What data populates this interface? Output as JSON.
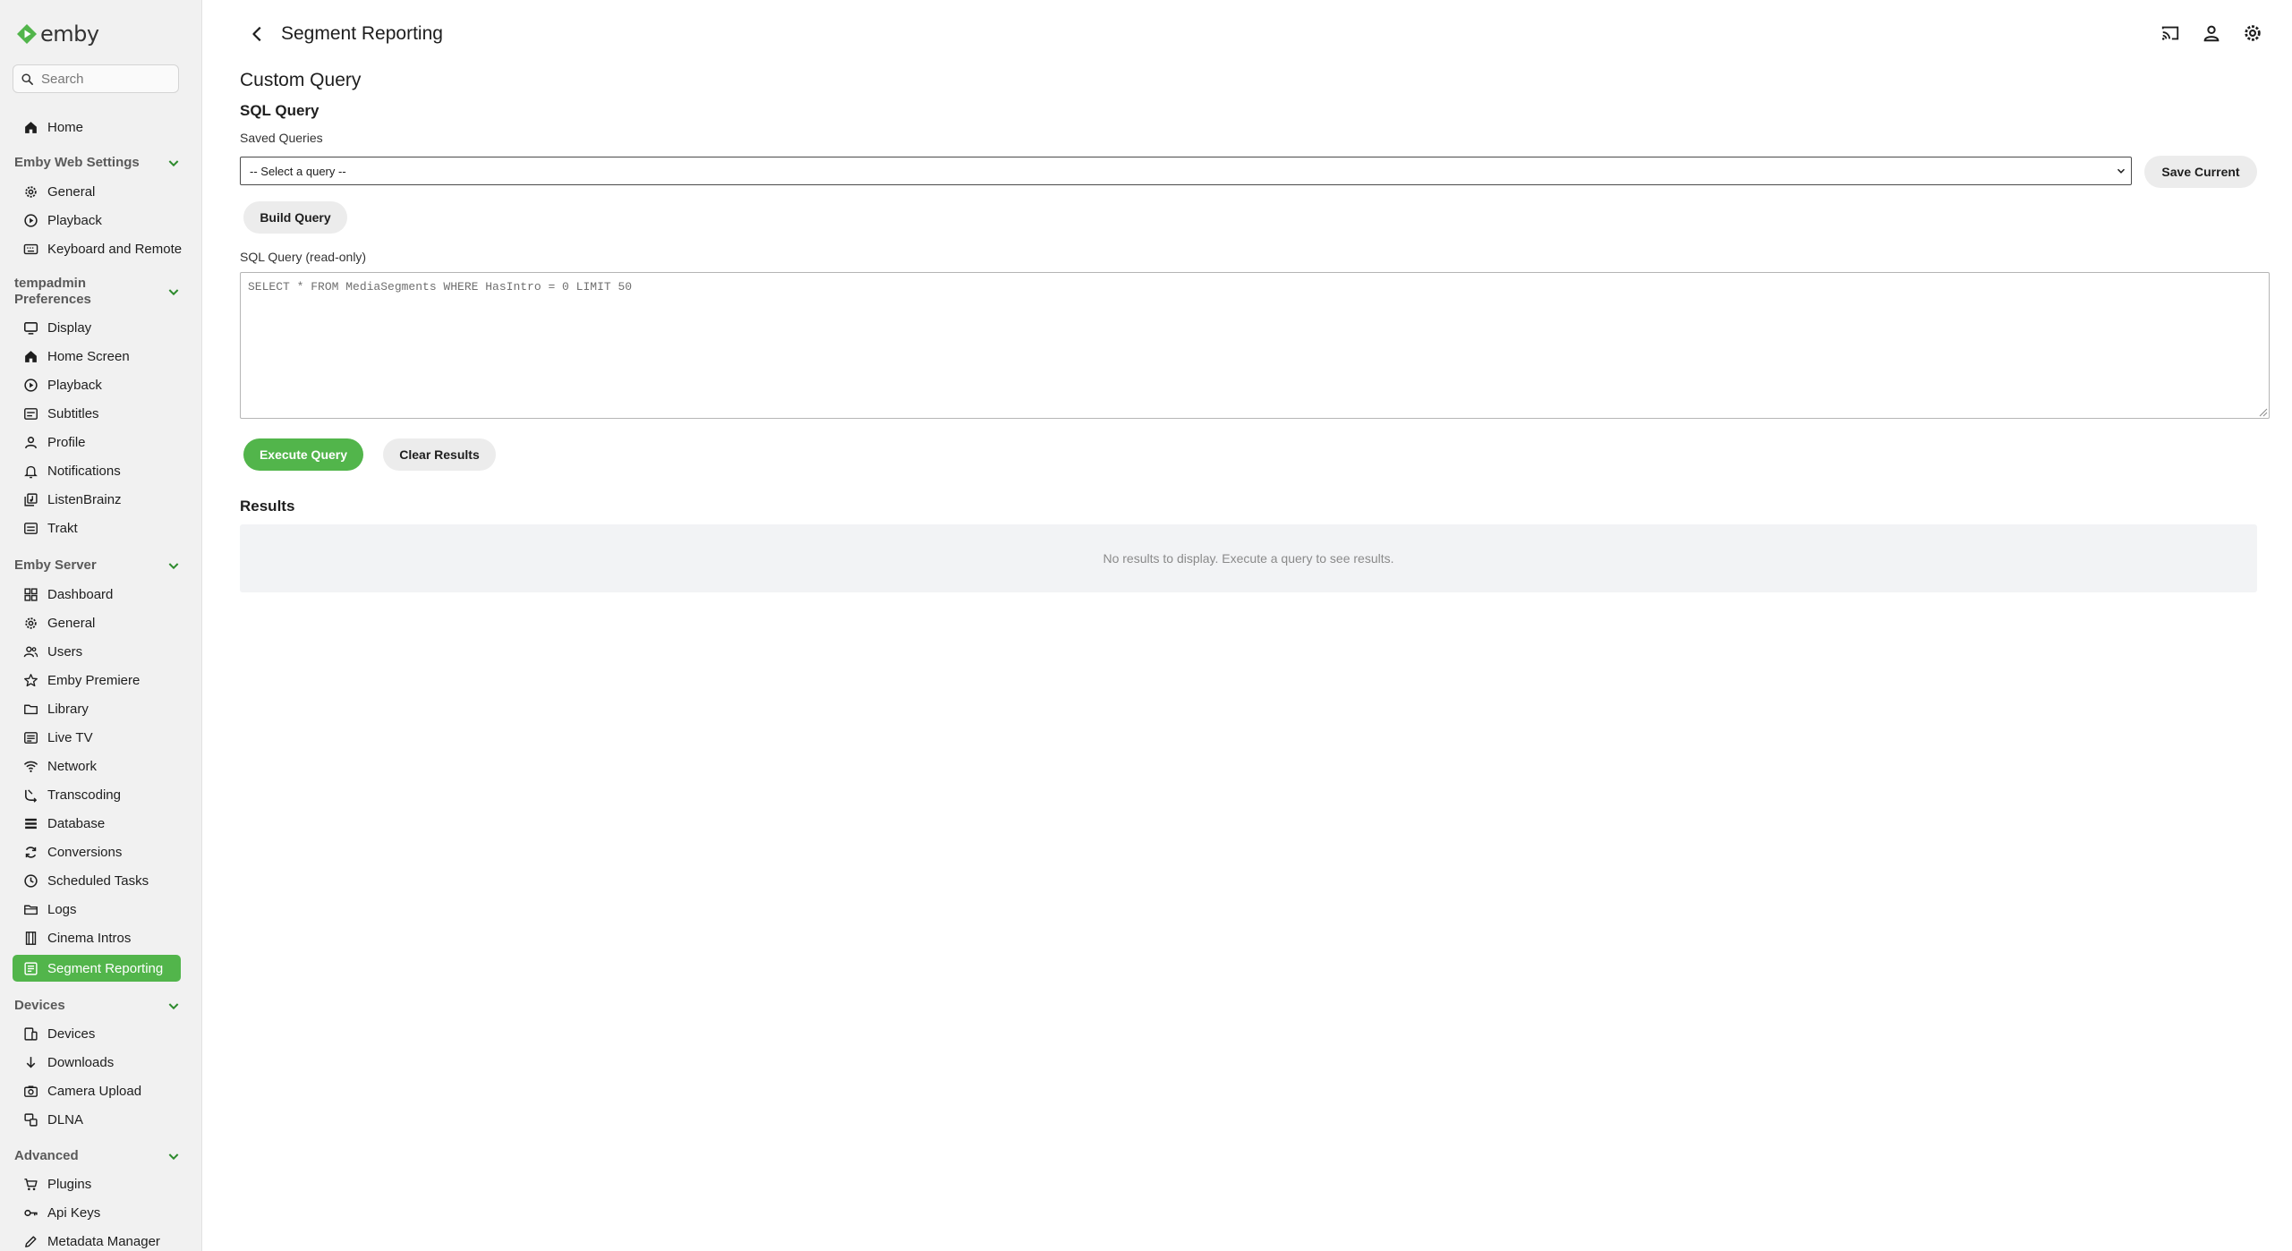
{
  "app": {
    "logo_text": "emby",
    "brand_color": "#52b54b"
  },
  "search": {
    "placeholder": "Search"
  },
  "header": {
    "title": "Segment Reporting"
  },
  "sidebar": {
    "home": "Home",
    "web_settings": {
      "title": "Emby Web Settings",
      "items": [
        "General",
        "Playback",
        "Keyboard and Remote"
      ]
    },
    "preferences": {
      "title_line1": "tempadmin",
      "title_line2": "Preferences",
      "items": [
        "Display",
        "Home Screen",
        "Playback",
        "Subtitles",
        "Profile",
        "Notifications",
        "ListenBrainz",
        "Trakt"
      ]
    },
    "server": {
      "title": "Emby Server",
      "items": [
        "Dashboard",
        "General",
        "Users",
        "Emby Premiere",
        "Library",
        "Live TV",
        "Network",
        "Transcoding",
        "Database",
        "Conversions",
        "Scheduled Tasks",
        "Logs",
        "Cinema Intros",
        "Segment Reporting"
      ]
    },
    "devices": {
      "title": "Devices",
      "items": [
        "Devices",
        "Downloads",
        "Camera Upload",
        "DLNA"
      ]
    },
    "advanced": {
      "title": "Advanced",
      "items": [
        "Plugins",
        "Api Keys",
        "Metadata Manager"
      ]
    }
  },
  "main": {
    "heading": "Custom Query",
    "subheading": "SQL Query",
    "saved_label": "Saved Queries",
    "select_value": "-- Select a query --",
    "save_current": "Save Current",
    "build_query": "Build Query",
    "sql_label": "SQL Query (read-only)",
    "sql_text": "SELECT * FROM MediaSegments WHERE HasIntro = 0 LIMIT 50",
    "execute": "Execute Query",
    "clear": "Clear Results",
    "results_title": "Results",
    "no_results": "No results to display. Execute a query to see results."
  }
}
